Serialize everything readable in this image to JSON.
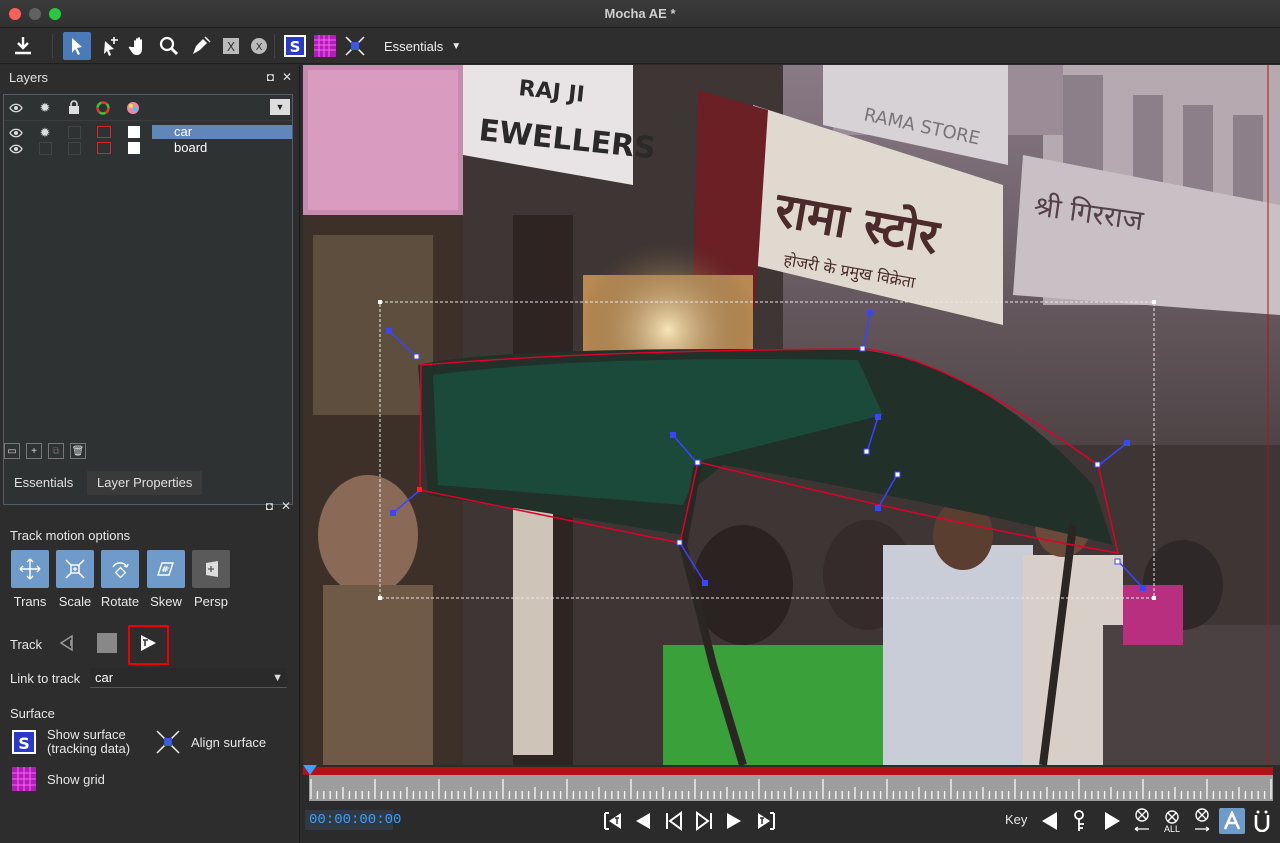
{
  "window": {
    "title": "Mocha AE *"
  },
  "toolbar": {
    "workspace": "Essentials"
  },
  "layers_panel": {
    "title": "Layers",
    "layers": [
      {
        "name": "car",
        "selected": true
      },
      {
        "name": "board",
        "selected": false
      }
    ]
  },
  "props_panel": {
    "tabs": [
      {
        "label": "Essentials"
      },
      {
        "label": "Layer Properties"
      }
    ],
    "track_motion_label": "Track motion options",
    "motion_options": [
      {
        "label": "Trans",
        "enabled": true
      },
      {
        "label": "Scale",
        "enabled": true
      },
      {
        "label": "Rotate",
        "enabled": true
      },
      {
        "label": "Skew",
        "enabled": true
      },
      {
        "label": "Persp",
        "enabled": false
      }
    ],
    "track_label": "Track",
    "link_label": "Link to track",
    "link_value": "car",
    "surface_label": "Surface",
    "show_surface_line1": "Show surface",
    "show_surface_line2": "(tracking data)",
    "align_surface": "Align surface",
    "show_grid": "Show grid"
  },
  "playback": {
    "timecode": "00:00:00:00",
    "key_label": "Key",
    "all_label": "ALL"
  },
  "viewer": {
    "sign_rama": "रामा स्टोर",
    "sign_rama_sub": "होजरी के प्रमुख विक्रेता",
    "sign_jewellers": "EWELLERS",
    "sign_top": "RAMA STORE",
    "sign_right": "श्री गिरराज",
    "sign_raj": "RAJ JI"
  },
  "colors": {
    "accent": "#5f87b9",
    "highlight": "#e00000",
    "spline": "#e0002a",
    "timecode": "#3aa0ff"
  }
}
